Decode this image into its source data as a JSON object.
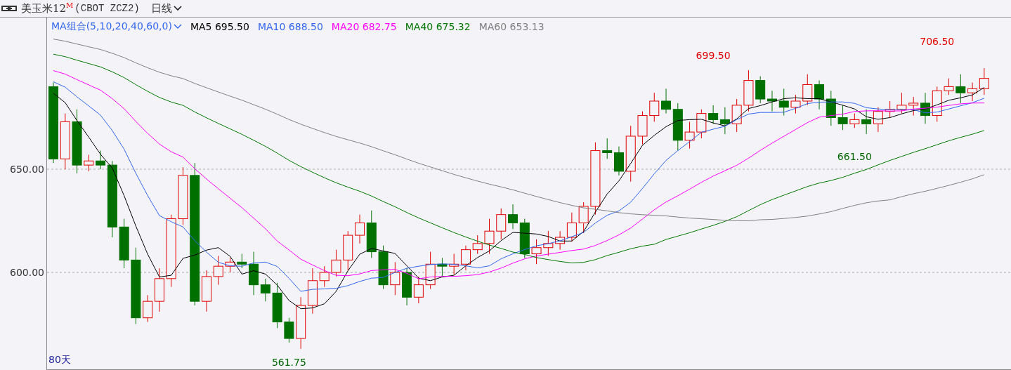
{
  "header": {
    "symbol": "美玉米12",
    "contract_mark": "M",
    "code": "(CBOT ZCZ2)",
    "period": "日线"
  },
  "legend": {
    "selector": "MA组合(5,10,20,40,60,0)",
    "items": [
      {
        "label": "MA5 695.50",
        "color": "#000000"
      },
      {
        "label": "MA10 688.50",
        "color": "#3366ee"
      },
      {
        "label": "MA20 682.75",
        "color": "#ff00ff"
      },
      {
        "label": "MA40 675.32",
        "color": "#007700"
      },
      {
        "label": "MA60 653.13",
        "color": "#808080"
      }
    ]
  },
  "y_axis": [
    "650.00",
    "600.00"
  ],
  "annotations": [
    {
      "text": "699.50",
      "kind": "high"
    },
    {
      "text": "706.50",
      "kind": "high"
    },
    {
      "text": "661.50",
      "kind": "low"
    },
    {
      "text": "561.75",
      "kind": "low"
    }
  ],
  "range_label": "80天"
}
